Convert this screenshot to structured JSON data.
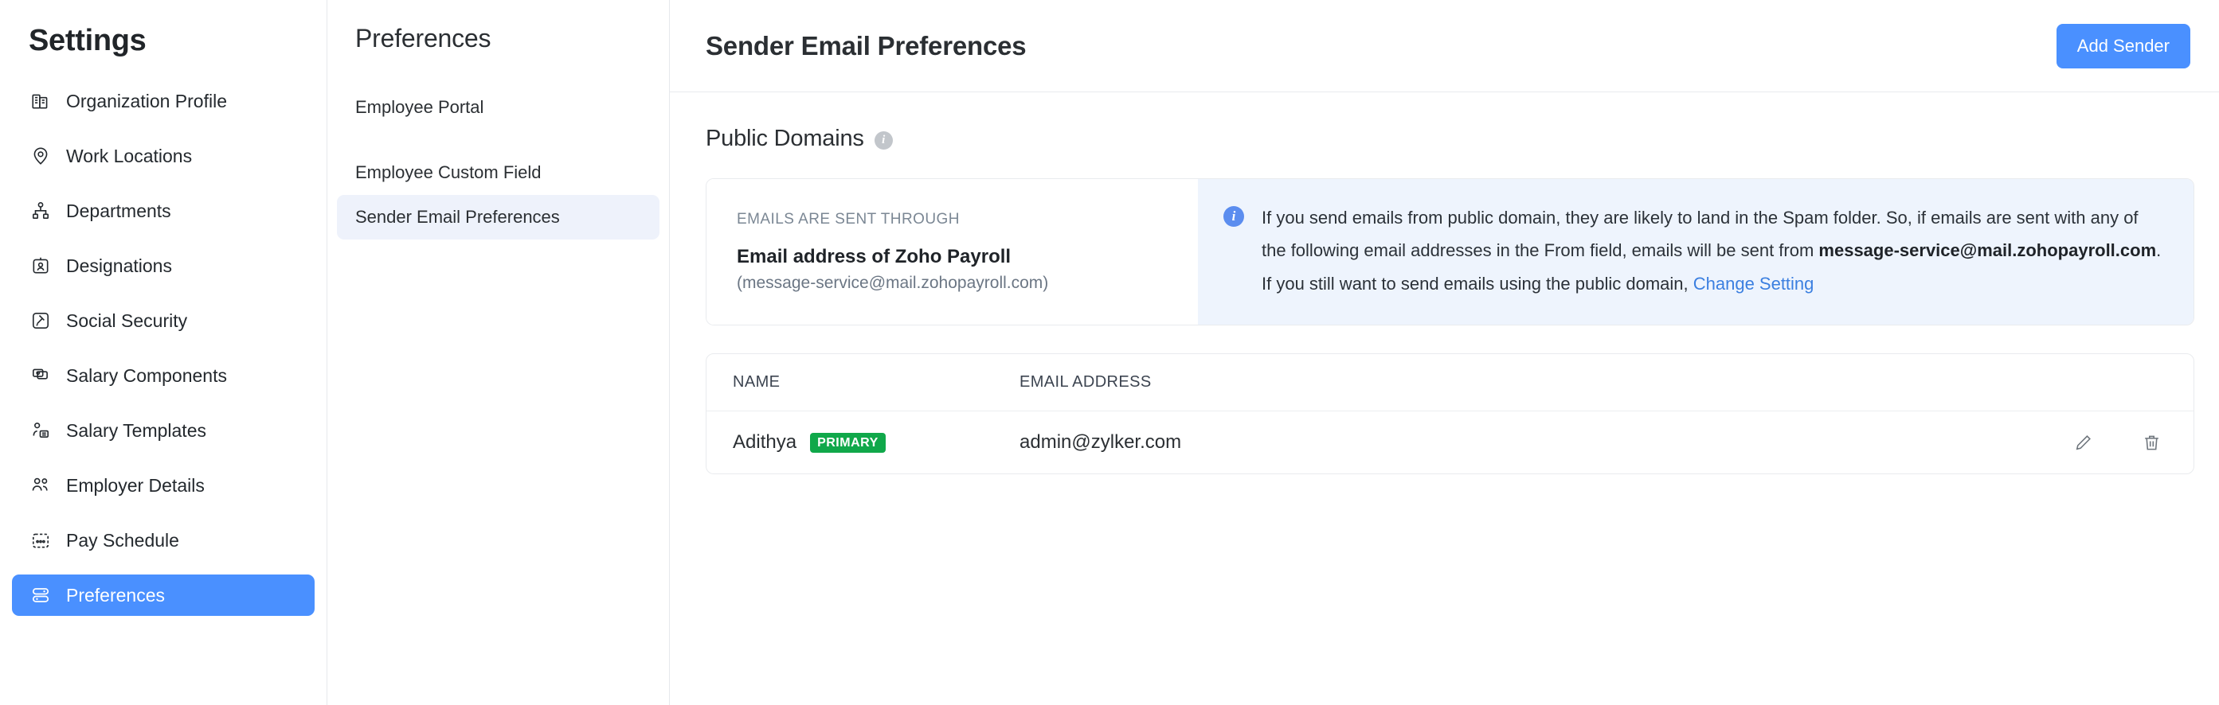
{
  "sidebar": {
    "title": "Settings",
    "items": [
      {
        "label": "Organization Profile",
        "icon": "building-icon",
        "active": false
      },
      {
        "label": "Work Locations",
        "icon": "location-pin-icon",
        "active": false
      },
      {
        "label": "Departments",
        "icon": "org-chart-icon",
        "active": false
      },
      {
        "label": "Designations",
        "icon": "id-badge-icon",
        "active": false
      },
      {
        "label": "Social Security",
        "icon": "gavel-icon",
        "active": false
      },
      {
        "label": "Salary Components",
        "icon": "money-cards-icon",
        "active": false
      },
      {
        "label": "Salary Templates",
        "icon": "person-document-icon",
        "active": false
      },
      {
        "label": "Employer Details",
        "icon": "people-icon",
        "active": false
      },
      {
        "label": "Pay Schedule",
        "icon": "calendar-icon",
        "active": false
      },
      {
        "label": "Preferences",
        "icon": "sliders-icon",
        "active": true
      }
    ]
  },
  "midpanel": {
    "title": "Preferences",
    "items": [
      {
        "label": "Employee Portal",
        "selected": false
      },
      {
        "label": "Employee Custom Field",
        "selected": false
      },
      {
        "label": "Sender Email Preferences",
        "selected": true
      }
    ]
  },
  "header": {
    "title": "Sender Email Preferences",
    "add_sender_label": "Add Sender"
  },
  "section": {
    "title": "Public Domains",
    "info_icon": "info-icon",
    "info_glyph": "i"
  },
  "banner": {
    "sent_through_label": "EMAILS ARE SENT THROUGH",
    "sent_through_value": "Email address of Zoho Payroll",
    "sent_through_sub": "(message-service@mail.zohopayroll.com)",
    "info_icon": "info-icon",
    "info_glyph": "i",
    "text_part1": "If you send emails from public domain, they are likely to land in the Spam folder. So, if emails are sent with any of the following email addresses in the From field, emails will be sent from ",
    "text_bold": "message-service@mail.zohopayroll.com",
    "text_part2": ". If you still want to send emails using the public domain, ",
    "link_label": "Change Setting"
  },
  "table": {
    "columns": [
      "NAME",
      "EMAIL ADDRESS"
    ],
    "rows": [
      {
        "name": "Adithya",
        "badge": "PRIMARY",
        "email": "admin@zylker.com",
        "edit_icon": "pencil-icon",
        "delete_icon": "trash-icon"
      }
    ]
  },
  "colors": {
    "accent_blue": "#4a90ff",
    "badge_green": "#10a84a",
    "banner_bg": "#eef4fd",
    "link_blue": "#3b7fe0",
    "selected_bg": "#eef2fb"
  }
}
